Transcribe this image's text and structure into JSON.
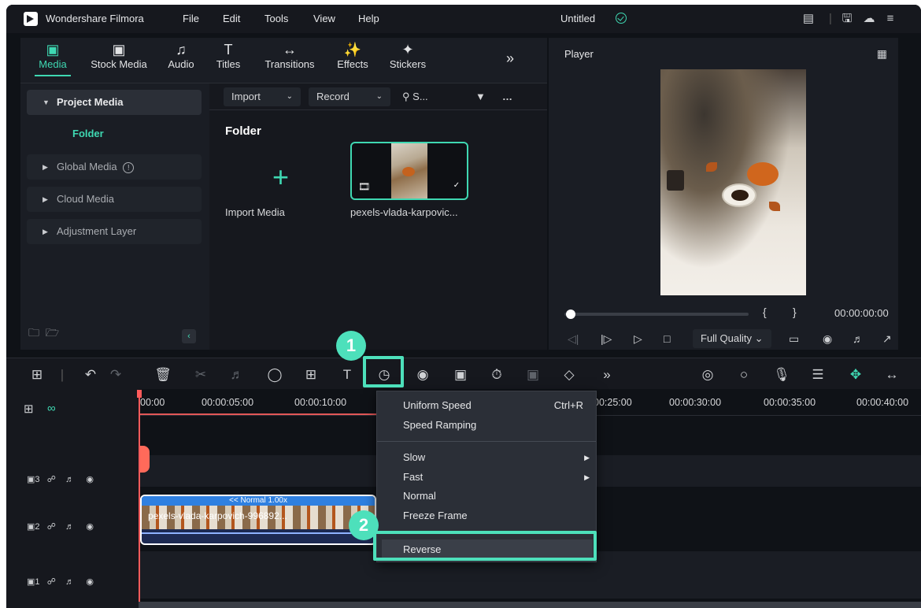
{
  "titlebar": {
    "app_name": "Wondershare Filmora",
    "menus": [
      "File",
      "Edit",
      "Tools",
      "View",
      "Help"
    ],
    "doc_title": "Untitled"
  },
  "media_tabs": [
    {
      "label": "Media",
      "icon": "media-icon",
      "active": true
    },
    {
      "label": "Stock Media",
      "icon": "stock-media-icon"
    },
    {
      "label": "Audio",
      "icon": "music-note-icon"
    },
    {
      "label": "Titles",
      "icon": "text-t-icon"
    },
    {
      "label": "Transitions",
      "icon": "transition-arrows-icon"
    },
    {
      "label": "Effects",
      "icon": "sparkle-icon"
    },
    {
      "label": "Stickers",
      "icon": "sticker-icon"
    }
  ],
  "sidebar": {
    "project_media": "Project Media",
    "folder": "Folder",
    "global_media": "Global Media",
    "cloud_media": "Cloud Media",
    "adjustment_layer": "Adjustment Layer"
  },
  "content": {
    "import_label": "Import",
    "record_label": "Record",
    "search_placeholder": "S...",
    "folder_title": "Folder",
    "import_media": "Import Media",
    "clip_name": "pexels-vlada-karpovic..."
  },
  "player": {
    "title": "Player",
    "timecode": "00:00:00:00",
    "quality": "Full Quality"
  },
  "timeline": {
    "ticks": [
      "00:00",
      "00:00:05:00",
      "00:00:10:00",
      "00:25:00",
      "00:00:30:00",
      "00:00:35:00",
      "00:00:40:00"
    ],
    "tracks": [
      "3",
      "2",
      "1"
    ],
    "clip_speed": "<< Normal 1.00x",
    "clip_label": "pexels-vlada-karpovich-996892..."
  },
  "context_menu": {
    "uniform_speed": "Uniform Speed",
    "uniform_shortcut": "Ctrl+R",
    "speed_ramping": "Speed Ramping",
    "slow": "Slow",
    "fast": "Fast",
    "normal": "Normal",
    "freeze_frame": "Freeze Frame",
    "reverse": "Reverse"
  },
  "badges": {
    "one": "1",
    "two": "2"
  },
  "colors": {
    "accent": "#3fd8b2",
    "highlight": "#4de0bb",
    "playhead": "#ff5b5b"
  }
}
